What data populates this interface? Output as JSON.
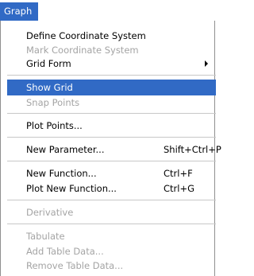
{
  "menu": {
    "title": "Graph",
    "items": [
      {
        "label": "Define Coordinate System",
        "shortcut": "",
        "disabled": false
      },
      {
        "label": "Mark Coordinate System",
        "shortcut": "",
        "disabled": true
      },
      {
        "label": "Grid Form",
        "shortcut": "",
        "disabled": false,
        "submenu": true
      },
      {
        "label": "Show Grid",
        "shortcut": "",
        "disabled": false,
        "selected": true
      },
      {
        "label": "Snap Points",
        "shortcut": "",
        "disabled": true
      },
      {
        "label": "Plot Points...",
        "shortcut": "",
        "disabled": false
      },
      {
        "label": "New Parameter...",
        "shortcut": "Shift+Ctrl+P",
        "disabled": false
      },
      {
        "label": "New Function...",
        "shortcut": "Ctrl+F",
        "disabled": false
      },
      {
        "label": "Plot New Function...",
        "shortcut": "Ctrl+G",
        "disabled": false
      },
      {
        "label": "Derivative",
        "shortcut": "",
        "disabled": true
      },
      {
        "label": "Tabulate",
        "shortcut": "",
        "disabled": true
      },
      {
        "label": "Add Table Data...",
        "shortcut": "",
        "disabled": true
      },
      {
        "label": "Remove Table Data...",
        "shortcut": "",
        "disabled": true
      }
    ]
  },
  "colors": {
    "highlight": "#316ac5",
    "disabled_text": "#a4a4a4"
  }
}
